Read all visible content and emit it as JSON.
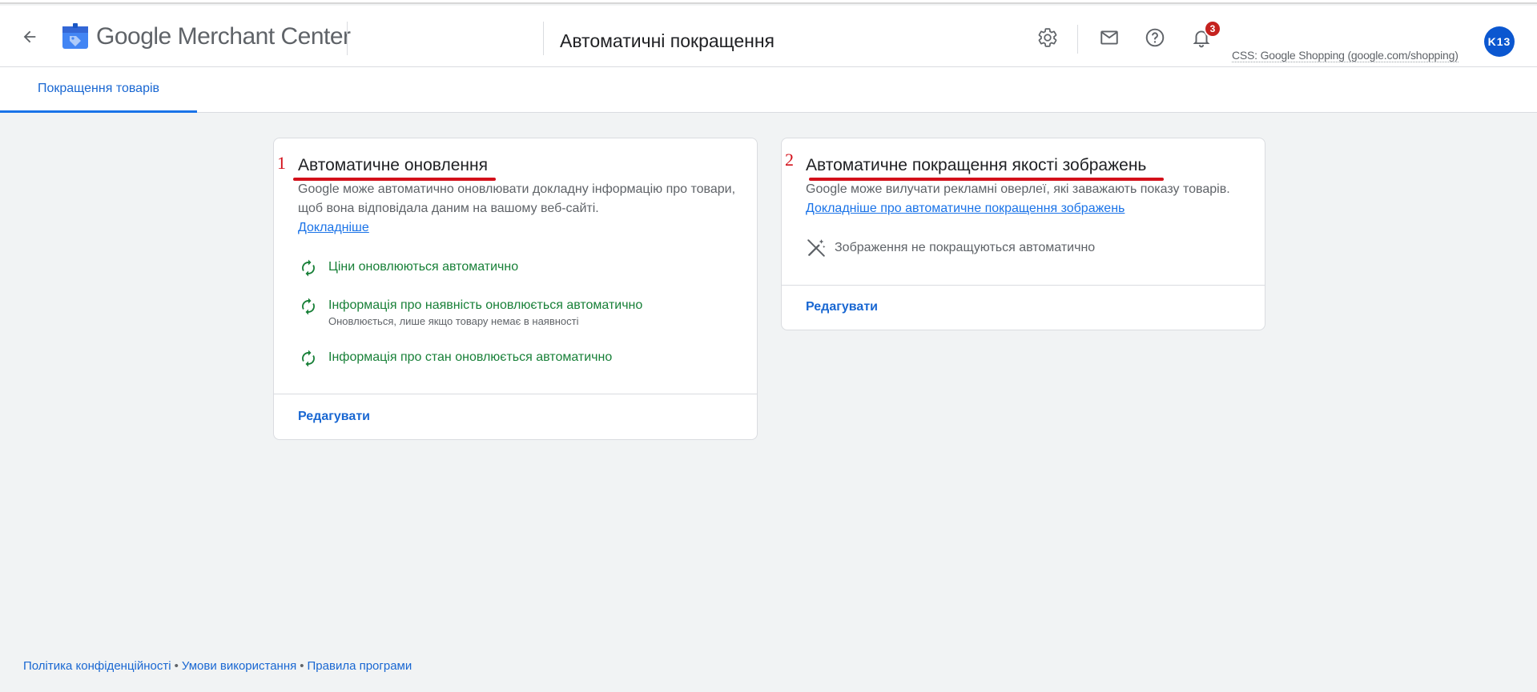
{
  "header": {
    "brand_google": "Google",
    "brand_product": "Merchant Center",
    "page_title": "Автоматичні покращення",
    "notification_count": "3",
    "account_label": "CSS: Google Shopping (google.com/shopping)",
    "avatar_initials": "K13"
  },
  "tabs": [
    {
      "label": "Покращення товарів",
      "active": true
    }
  ],
  "cards": [
    {
      "annotation_number": "1",
      "title": "Автоматичне оновлення",
      "description": "Google може автоматично оновлювати докладну інформацію про товари, щоб вона відповідала даним на вашому веб-сайті.",
      "learn_more": "Докладніше",
      "features": [
        {
          "icon": "sync-icon",
          "label": "Ціни оновлюються автоматично",
          "sub": ""
        },
        {
          "icon": "sync-icon",
          "label": "Інформація про наявність оновлюється автоматично",
          "sub": "Оновлюється, лише якщо товару немає в наявності"
        },
        {
          "icon": "sync-icon",
          "label": "Інформація про стан оновлюється автоматично",
          "sub": ""
        }
      ],
      "edit_label": "Редагувати"
    },
    {
      "annotation_number": "2",
      "title": "Автоматичне покращення якості зображень",
      "description": "Google може вилучати рекламні оверлеї, які заважають показу товарів.",
      "learn_more": "Докладніше про автоматичне покращення зображень",
      "status": {
        "icon": "magic-wand-off-icon",
        "label": "Зображення не покращуються автоматично"
      },
      "edit_label": "Редагувати"
    }
  ],
  "footer": {
    "links": [
      "Політика конфіденційності",
      "Умови використання",
      "Правила програми"
    ],
    "separator": "•"
  },
  "colors": {
    "accent": "#1a73e8",
    "success": "#188038",
    "annotation_red": "#d3101a",
    "background": "#f1f3f4"
  }
}
